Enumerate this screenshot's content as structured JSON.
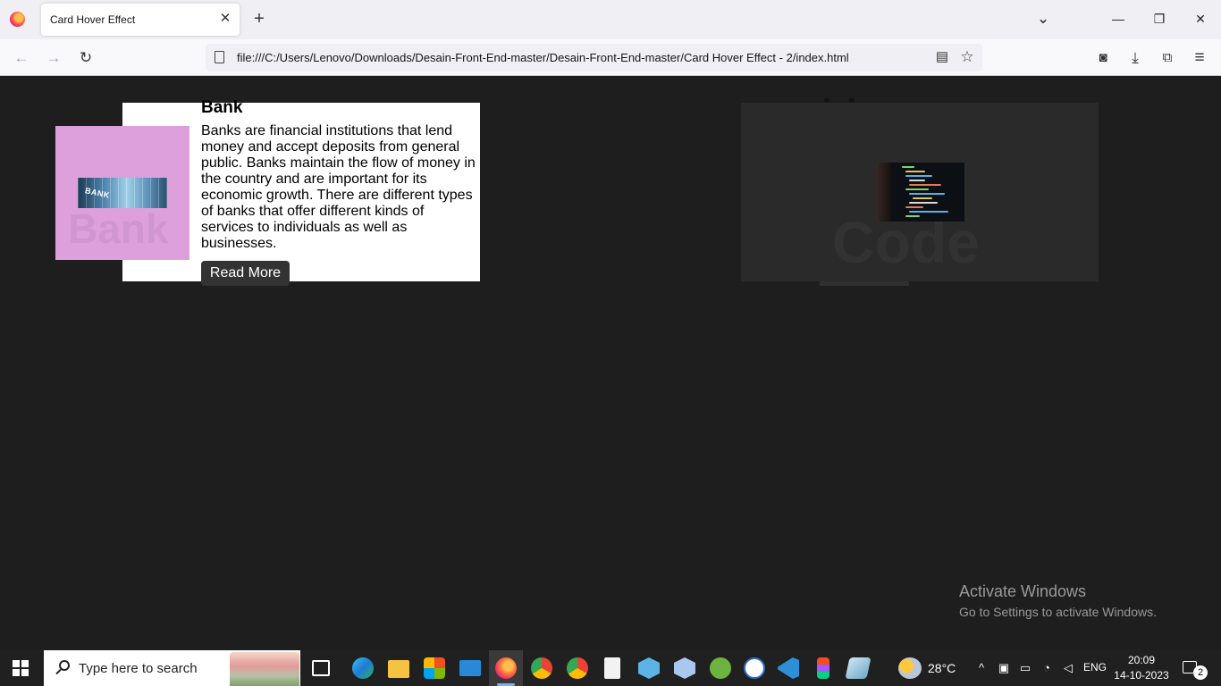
{
  "browser": {
    "tab_title": "Card Hover Effect",
    "tab_close": "✕",
    "new_tab": "+",
    "tab_list": "⌄",
    "minimize": "—",
    "restore": "❐",
    "close": "✕",
    "url": "file:///C:/Users/Lenovo/Downloads/Desain-Front-End-master/Desain-Front-End-master/Card Hover Effect - 2/index.html",
    "back": "←",
    "forward": "→",
    "reload": "↻",
    "reader_icon": "▤",
    "bookmark_icon": "☆",
    "pocket_icon": "◙",
    "download_icon": "⤓",
    "extensions_icon": "⧉",
    "menu_icon": "≡"
  },
  "cards": [
    {
      "title": "Bank",
      "watermark": "Bank",
      "image_label": "BANK",
      "text": "Banks are financial institutions that lend money and accept deposits from general public. Banks maintain the flow of money in the country and are important for its economic growth. There are different types of banks that offer different kinds of services to individuals as well as businesses.",
      "button": "Read More",
      "image_bg": "#dda0dd"
    },
    {
      "watermark": "Code",
      "card_bg": "#2a2a2a"
    }
  ],
  "watermark_notice": {
    "title": "Activate Windows",
    "subtitle": "Go to Settings to activate Windows."
  },
  "taskbar": {
    "search_placeholder": "Type here to search",
    "weather": "28°C",
    "language": "ENG",
    "time": "20:09",
    "date": "14-10-2023",
    "notification_count": "2",
    "tray_chevron": "^"
  }
}
